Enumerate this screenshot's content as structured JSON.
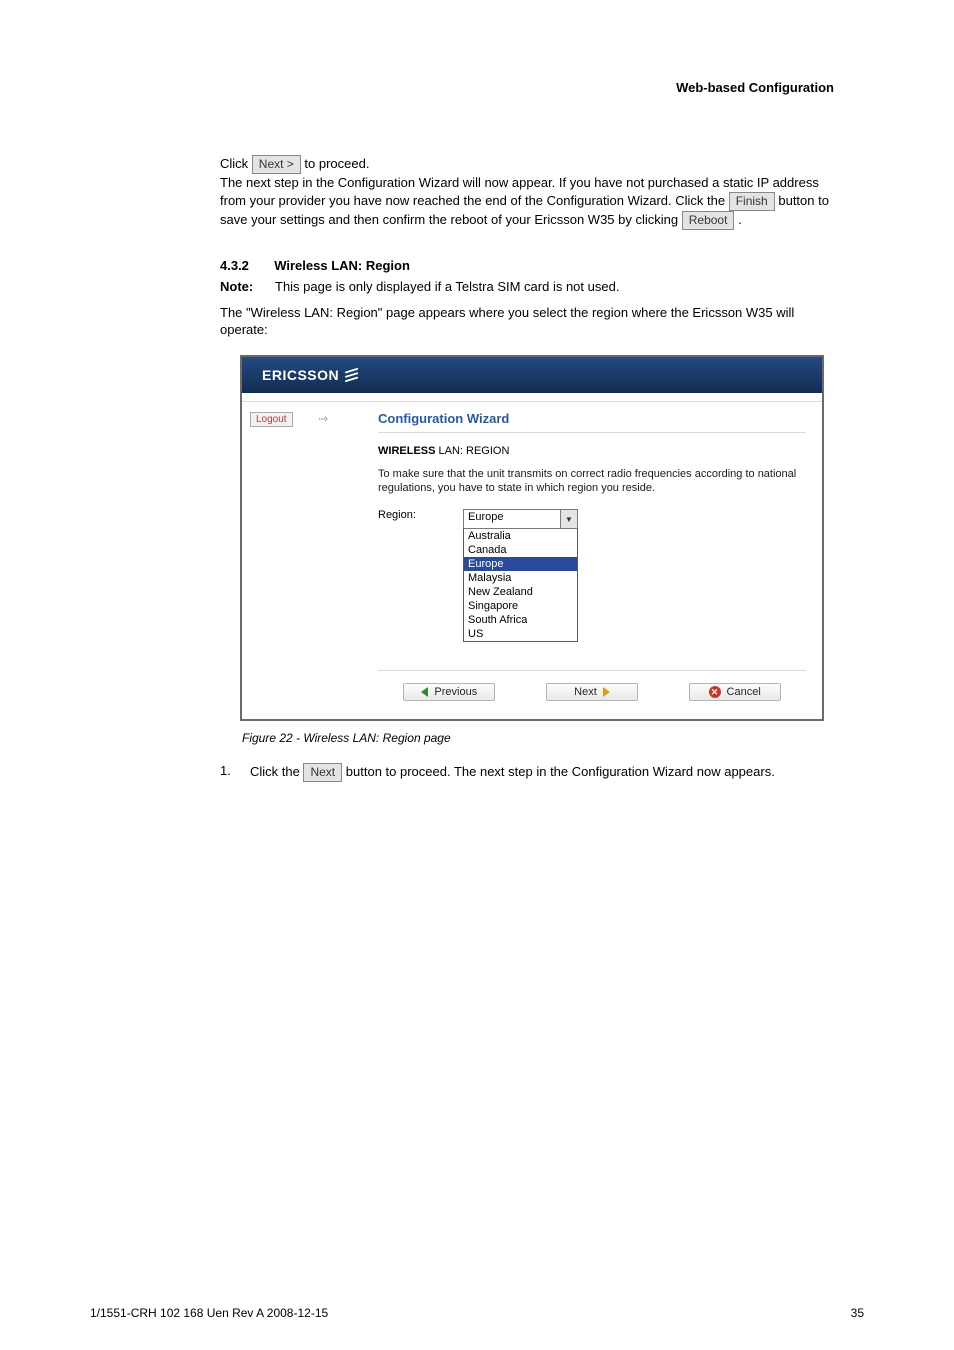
{
  "header": {
    "text": "Web-based Configuration"
  },
  "para1": {
    "seg1": "Click ",
    "btn1": "Next >",
    "seg2": " to proceed.",
    "seg3": "The next step in the Configuration Wizard will now appear. If you have not purchased a static IP address from your provider you have now reached the end of the Configuration Wizard. Click the ",
    "btn2": "Finish",
    "seg4": " button to save your settings and then confirm the reboot of your Ericsson W35 by clicking ",
    "btn3": "Reboot",
    "seg5": "."
  },
  "heading": {
    "num": "4.3.2",
    "title": "Wireless LAN: Region"
  },
  "notebox": {
    "label": "Note:",
    "text": "This page is only displayed if a Telstra SIM card is not used."
  },
  "para2": "The \"Wireless LAN: Region\" page appears where you select the region where the Ericsson W35 will operate:",
  "figure": {
    "brand_text": "ERICSSON",
    "logout_label": "Logout",
    "breadcrumb_arrow": "····›",
    "title": "Configuration Wizard",
    "wl_prefix": "WIRELESS",
    "wl_rest": " LAN: REGION",
    "desc": "To make sure that the unit transmits on correct radio frequencies according to national regulations, you have to state in which region you reside.",
    "region_label": "Region:",
    "selected": "Europe",
    "options": [
      "Australia",
      "Canada",
      "Europe",
      "Malaysia",
      "New Zealand",
      "Singapore",
      "South Africa",
      "US"
    ],
    "btn_prev": "Previous",
    "btn_next": "Next",
    "btn_cancel": "Cancel"
  },
  "caption": "Figure 22 - Wireless LAN: Region page",
  "step": {
    "num": "1.",
    "text": "Click the "
  },
  "step_btn": "Next",
  "step_after": " button to proceed. The next step in the Configuration Wizard now appears.",
  "footer": {
    "left": "1/1551-CRH 102 168 Uen Rev A  2008-12-15",
    "right": "35"
  }
}
